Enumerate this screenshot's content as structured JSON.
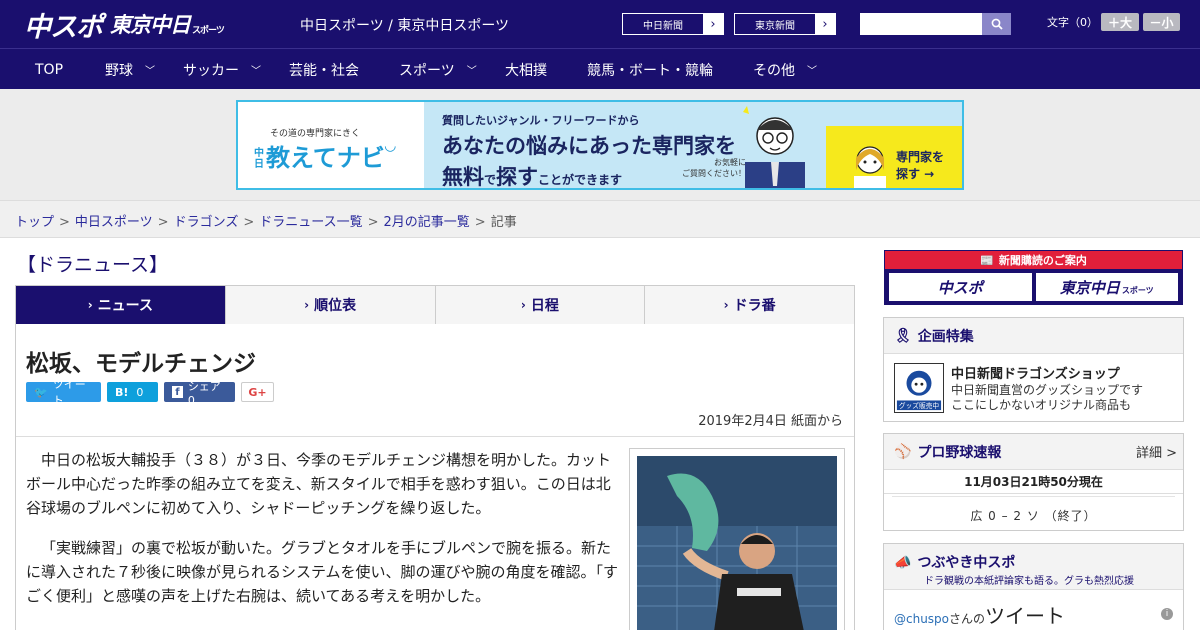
{
  "header": {
    "logo_chuspo": "中スポ",
    "logo_tokyo": "東京中日",
    "logo_tokyo_suffix": "スポーツ",
    "site_title": "中日スポーツ / 東京中日スポーツ",
    "link_chunichi": "中日新聞",
    "link_tokyo": "東京新聞",
    "search_placeholder": "",
    "font_size_label": "文字（0）",
    "size_up": "＋大",
    "size_down": "－小"
  },
  "nav": [
    {
      "label": "TOP",
      "has_menu": false
    },
    {
      "label": "野球",
      "has_menu": true
    },
    {
      "label": "サッカー",
      "has_menu": true
    },
    {
      "label": "芸能・社会",
      "has_menu": false
    },
    {
      "label": "スポーツ",
      "has_menu": true
    },
    {
      "label": "大相撲",
      "has_menu": false
    },
    {
      "label": "競馬・ボート・競輪",
      "has_menu": false
    },
    {
      "label": "その他",
      "has_menu": true
    }
  ],
  "ad": {
    "tag": "その道の専門家にきく",
    "brand_small": "中日",
    "brand": "教えてナビ",
    "line1": "質問したいジャンル・フリーワードから",
    "line2": "あなたの悩みにあった専門家を",
    "line3_a": "無料",
    "line3_b": "で",
    "line3_c": "探す",
    "line3_d": "ことができます",
    "note_1": "お気軽に",
    "note_2": "ご質問ください！",
    "cta_1": "専門家を",
    "cta_2": "探す →"
  },
  "breadcrumb": {
    "items": [
      "トップ",
      "中日スポーツ",
      "ドラゴンズ",
      "ドラニュース一覧",
      "2月の記事一覧"
    ],
    "current": "記事"
  },
  "section_title": "【ドラニュース】",
  "tabs": [
    {
      "label": "ニュース",
      "active": true
    },
    {
      "label": "順位表",
      "active": false
    },
    {
      "label": "日程",
      "active": false
    },
    {
      "label": "ドラ番",
      "active": false
    }
  ],
  "article": {
    "title": "松坂、モデルチェンジ",
    "share_tweet": "ツイート",
    "share_hatena": "0",
    "share_facebook": "シェア 0",
    "share_gplus": "G+",
    "date": "2019年2月4日 紙面から",
    "paragraphs": [
      "中日の松坂大輔投手（３８）が３日、今季のモデルチェンジ構想を明かした。カットボール中心だった昨季の組み立てを変え、新スタイルで相手を惑わす狙い。この日は北谷球場のブルペンに初めて入り、シャドーピッチングを繰り返した。",
      "「実戦練習」の裏で松坂が動いた。グラブとタオルを手にブルペンで腕を振る。新たに導入された７秒後に映像が見られるシステムを使い、脚の運びや腕の角度を確認。「すごく便利」と感嘆の声を上げた右腕は、続いてある考えを明かした。"
    ]
  },
  "sidebar": {
    "subscribe_head": "新聞購読のご案内",
    "subscribe_logo_1": "中スポ",
    "subscribe_logo_2": "東京中日",
    "feature_head": "企画特集",
    "shop_title": "中日新聞ドラゴンズショップ",
    "shop_desc_1": "中日新聞直営のグッズショップです",
    "shop_desc_2": "ここにしかないオリジナル商品も",
    "shop_badge": "グッズ販売中",
    "score_head": "プロ野球速報",
    "score_more": "詳細 >",
    "score_time": "11月03日21時50分現在",
    "score_line": "広 0 – 2 ソ （終了）",
    "tweet_head": "つぶやき中スポ",
    "tweet_sub": "ドラ観戦の本紙評論家も語る。グラも熱烈応援",
    "tweet_handle": "@chuspo",
    "tweet_san": "さんの",
    "tweet_word": "ツイート"
  },
  "colors": {
    "brand_navy": "#1a0f6e",
    "ad_cyan": "#3fbde6",
    "subscribe_red": "#e11f3a"
  }
}
